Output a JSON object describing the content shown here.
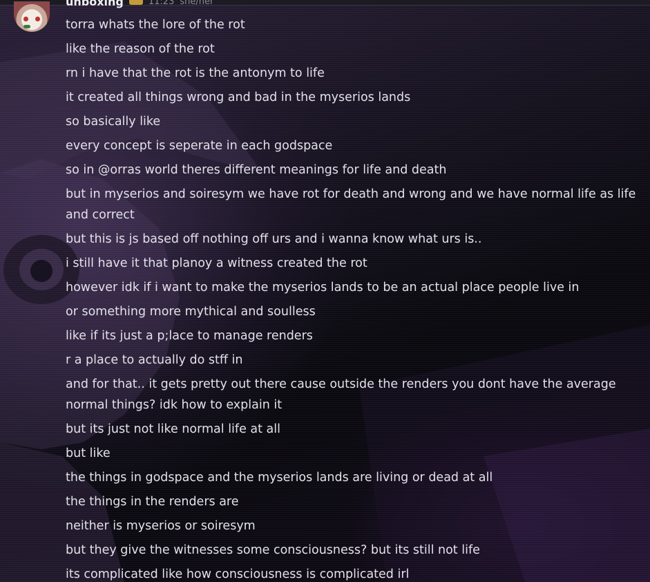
{
  "header": {
    "username": "unboxing",
    "timestamp": "11:23",
    "pronouns": "she/her"
  },
  "messages": [
    "torra whats the lore of the rot",
    "like the reason of the rot",
    "rn i have that the rot is the antonym to life",
    "it created all things wrong and bad in the myserios lands",
    "so basically like",
    "every concept is seperate in each godspace",
    "so in @orras world theres different meanings for life and death",
    "but in myserios and soiresym we have rot for death and wrong and we have normal life as life and correct",
    "but this is js based off nothing off urs and i wanna know what urs is..",
    "i still have it that planoy a witness created the rot",
    "however idk if i want to make the myserios lands to be an actual place people live in",
    "or something more mythical and soulless",
    "like if its just a p;lace to manage renders",
    "r a place to actually do stff in",
    "and for that.. it gets pretty out there cause outside the renders you dont have the average normal things? idk how to explain it",
    "but its just not like normal life at all",
    "but like",
    "the things in godspace and the myserios lands are living or dead at all",
    "the things in the renders are",
    "neither is myserios or soiresym",
    "but they give the witnesses some consciousness? but its still not life",
    "its complicated like how consciousness is complicated irl"
  ]
}
